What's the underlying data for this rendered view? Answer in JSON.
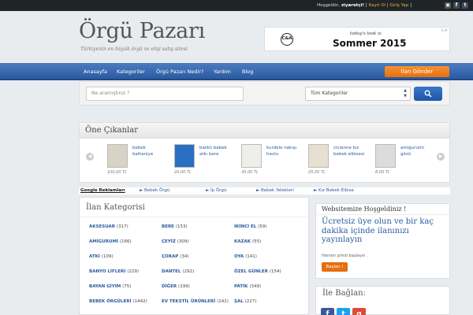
{
  "topbar": {
    "greeting": "Hoşgeldin, ",
    "username": "ziyaretçi!",
    "sep1": " [ ",
    "register": "Kayıt Ol",
    "sep2": " | ",
    "login": "Giriş Yap",
    "sep3": " ]",
    "icons": [
      "rss-icon",
      "facebook-icon",
      "twitter-icon"
    ]
  },
  "header": {
    "site_title": "Örgü Pazarı",
    "tagline": "Türkiyenin en büyük örgü ve elişi satış sitesi"
  },
  "ad_banner": {
    "logo_text": "C&A",
    "tagline": "today's look is",
    "headline": "Sommer 2015",
    "adchoices": "▷×"
  },
  "nav": {
    "items": [
      "Anasayfa",
      "Kategoriler",
      "Örgü Pazarı Nedir?",
      "Yardım",
      "Blog"
    ],
    "post_button": "İlan Gönder"
  },
  "search": {
    "placeholder": "Ne aramıştınız ?",
    "category_selected": "Tüm Kategoriler"
  },
  "featured": {
    "title": "Öne Çıkanlar",
    "items": [
      {
        "name": "bebek battaniye",
        "price": "100,00 TL"
      },
      {
        "name": "balıklı bebek atkı bere",
        "price": "20,00 TL"
      },
      {
        "name": "kurdele nakışı havlu",
        "price": "30,00 TL"
      },
      {
        "name": "ciciannе kız bebek elbisesi",
        "price": "25,00 TL"
      },
      {
        "name": "amigurumi gözü",
        "price": "8,00 TL"
      }
    ]
  },
  "ad_links": {
    "lead": "Google Reklamları",
    "links": [
      "► Bebek Örgü",
      "► İp Örgü",
      "► Bebek Yelekleri",
      "► Kız Bebek Elbise"
    ]
  },
  "categories": {
    "title": "İlan Kategorisi",
    "items": [
      {
        "name": "AKSESUAR",
        "count": "(317)"
      },
      {
        "name": "BERE",
        "count": "(153)"
      },
      {
        "name": "İKİNCİ EL",
        "count": "(59)"
      },
      {
        "name": "AMİGURUMİ",
        "count": "(166)"
      },
      {
        "name": "ÇEYİZ",
        "count": "(309)"
      },
      {
        "name": "KAZAK",
        "count": "(55)"
      },
      {
        "name": "ATKI",
        "count": "(109)"
      },
      {
        "name": "ÇORAP",
        "count": "(34)"
      },
      {
        "name": "OYA",
        "count": "(141)"
      },
      {
        "name": "BANYO LİFLERİ",
        "count": "(229)"
      },
      {
        "name": "DANTEL",
        "count": "(292)"
      },
      {
        "name": "ÖZEL GÜNLER",
        "count": "(154)"
      },
      {
        "name": "BAYAN GİYİM",
        "count": "(75)"
      },
      {
        "name": "DİĞER",
        "count": "(199)"
      },
      {
        "name": "PATİK",
        "count": "(349)"
      },
      {
        "name": "BEBEK ÖRGÜLERİ",
        "count": "(1442)"
      },
      {
        "name": "EV TEKSTİL ÜRÜNLERİ",
        "count": "(142)"
      },
      {
        "name": "ŞAL",
        "count": "(227)"
      }
    ]
  },
  "welcome": {
    "title": "Websitemize Hoşgeldiniz !",
    "body": "Ücretsiz üye olun ve bir kaç dakika içinde ilanınızı yayınlayın",
    "sub": "Hemen şimdi başlayın .",
    "button": "Başlan !"
  },
  "connect": {
    "title": "İle Bağlan:",
    "icons": [
      "facebook-icon",
      "twitter-icon",
      "google-plus-icon"
    ]
  },
  "colors": {
    "nav": "#2c5aa0",
    "accent": "#e56e10",
    "link": "#2b5aa0"
  }
}
